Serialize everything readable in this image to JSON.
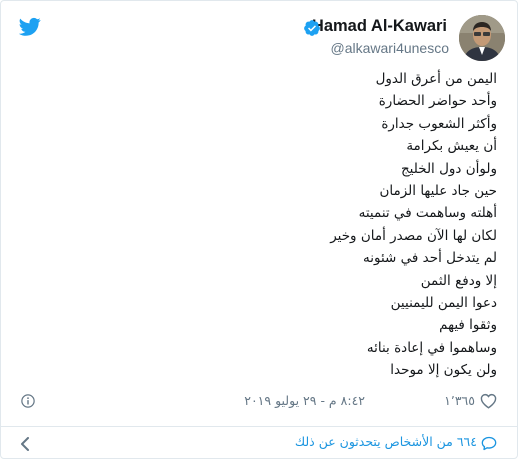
{
  "colors": {
    "brand_blue": "#1da1f2",
    "link_blue": "#1b95e0",
    "text_primary": "#14171a",
    "text_secondary": "#657786",
    "border": "#e1e8ed"
  },
  "header": {
    "author_name": "Hamad Al-Kawari",
    "author_handle": "@alkawari4unesco",
    "verified_icon": "verified-badge-icon",
    "logo_icon": "twitter-bird-icon"
  },
  "tweet": {
    "lines": [
      "اليمن من أعرق الدول",
      "وأحد حواضر الحضارة",
      "وأكثر الشعوب جدارة",
      "أن يعيش بكرامة",
      "ولوأن دول الخليج",
      "حين جاد عليها الزمان",
      "أهلته وساهمت في تنميته",
      "لكان لها الآن مصدر أمان وخير",
      "لم يتدخل أحد في شئونه",
      "إلا ودفع الثمن",
      "دعوا اليمن لليمنيين",
      "وثقوا فيهم",
      "وساهموا في إعادة بنائه",
      "ولن يكون إلا موحدا"
    ]
  },
  "footer": {
    "like_count": "١٬٣٦٥",
    "timestamp": "٨:٤٢ م - ٢٩ يوليو ٢٠١٩",
    "info_icon": "info-icon",
    "heart_icon": "heart-icon"
  },
  "conversation": {
    "link_text": "٦٦٤ من الأشخاص يتحدثون عن ذلك",
    "comment_icon": "comment-bubble-icon",
    "chevron_icon": "chevron-left-icon"
  }
}
